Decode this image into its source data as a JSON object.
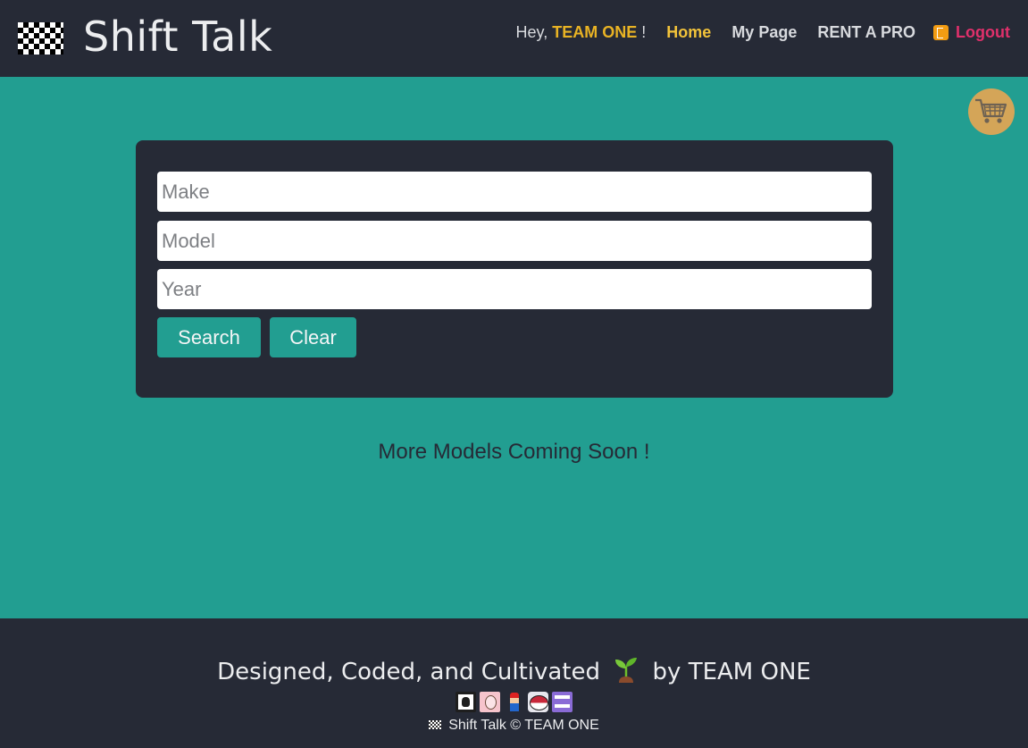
{
  "header": {
    "brand": "Shift Talk",
    "greeting_prefix": "Hey,",
    "user_name": "TEAM ONE",
    "greeting_suffix": "!",
    "nav": {
      "home": "Home",
      "my_page": "My Page",
      "rent_a_pro": "RENT A PRO",
      "logout": "Logout"
    }
  },
  "search": {
    "make_placeholder": "Make",
    "model_placeholder": "Model",
    "year_placeholder": "Year",
    "search_label": "Search",
    "clear_label": "Clear"
  },
  "main": {
    "coming_soon": "More Models Coming Soon !"
  },
  "footer": {
    "credit_prefix": "Designed, Coded, and Cultivated",
    "credit_suffix": "by TEAM ONE",
    "copyright": "Shift Talk © TEAM ONE"
  },
  "colors": {
    "header_bg": "#262a36",
    "teal": "#229e91",
    "home_active": "#f2c33a",
    "logout": "#e0306b",
    "cart": "#d4a558"
  },
  "icons": [
    "checkered-flag-icon",
    "logout-icon",
    "shopping-cart-icon",
    "seedling-icon"
  ]
}
